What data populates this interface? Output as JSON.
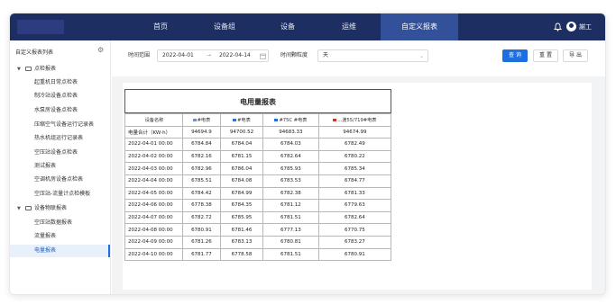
{
  "nav": {
    "items": [
      {
        "label": "首页"
      },
      {
        "label": "设备组"
      },
      {
        "label": "设备"
      },
      {
        "label": "运维"
      },
      {
        "label": "自定义报表"
      }
    ],
    "active_index": 4,
    "user": "謝工"
  },
  "sidebar": {
    "title": "自定义报表列表",
    "groups": [
      {
        "label": "点检报表",
        "expanded": true
      },
      {
        "label": "设备物联报表",
        "expanded": true
      }
    ],
    "items_group1": [
      {
        "label": "起重机日常点检表"
      },
      {
        "label": "制冷站设备点检表"
      },
      {
        "label": "水泵房设备点检表"
      },
      {
        "label": "压缩空气设备运行记录表"
      },
      {
        "label": "热水机组运行记录表"
      },
      {
        "label": "空压站设备点检表"
      },
      {
        "label": "测试报表"
      },
      {
        "label": "空调机房设备点检表"
      },
      {
        "label": "空压站-流量计点检模板"
      }
    ],
    "items_group2": [
      {
        "label": "空压站数据报表"
      },
      {
        "label": "流量报表"
      },
      {
        "label": "电量报表"
      }
    ]
  },
  "toolbar": {
    "time_range_label": "时间范围",
    "start_date": "2022-04-01",
    "arrow": "→",
    "end_date": "2022-04-14",
    "granularity_label": "时间颗粒度",
    "granularity_value": "天",
    "query_label": "查 询",
    "reset_label": "重 置",
    "export_label": "导 出"
  },
  "report": {
    "title": "电用量报表",
    "headers": [
      "设备名称",
      "#电表",
      "#电表",
      "#75C   #电表",
      "...渡55/719#电表"
    ],
    "total_label": "电量合计（KW·h）",
    "total": [
      "94694.9",
      "94700.52",
      "94683.33",
      "94674.99"
    ],
    "rows": [
      {
        "date": "2022-04-01 00:00",
        "v": [
          "6784.84",
          "6784.04",
          "6784.03",
          "6782.49"
        ]
      },
      {
        "date": "2022-04-02 00:00",
        "v": [
          "6782.16",
          "6781.15",
          "6782.64",
          "6780.22"
        ]
      },
      {
        "date": "2022-04-03 00:00",
        "v": [
          "6782.96",
          "6786.04",
          "6785.93",
          "6785.34"
        ]
      },
      {
        "date": "2022-04-04 00:00",
        "v": [
          "6785.51",
          "6784.08",
          "6783.53",
          "6784.77"
        ]
      },
      {
        "date": "2022-04-05 00:00",
        "v": [
          "6784.42",
          "6784.99",
          "6782.38",
          "6781.33"
        ]
      },
      {
        "date": "2022-04-06 00:00",
        "v": [
          "6778.38",
          "6784.35",
          "6781.12",
          "6779.63"
        ]
      },
      {
        "date": "2022-04-07 00:00",
        "v": [
          "6782.72",
          "6785.95",
          "6781.51",
          "6782.64"
        ]
      },
      {
        "date": "2022-04-08 00:00",
        "v": [
          "6780.91",
          "6781.46",
          "6777.13",
          "6770.75"
        ]
      },
      {
        "date": "2022-04-09 00:00",
        "v": [
          "6781.26",
          "6783.13",
          "6780.81",
          "6783.27"
        ]
      },
      {
        "date": "2022-04-10 00:00",
        "v": [
          "6781.77",
          "6778.58",
          "6781.51",
          "6780.91"
        ]
      }
    ]
  },
  "colors": {
    "nav_bg": "#1d2e63",
    "nav_active": "#33509a",
    "primary": "#1d6fe0",
    "legend": [
      "#7a8fb8",
      "#2f6fd6",
      "#c0392b",
      "#1d6fe0"
    ]
  }
}
